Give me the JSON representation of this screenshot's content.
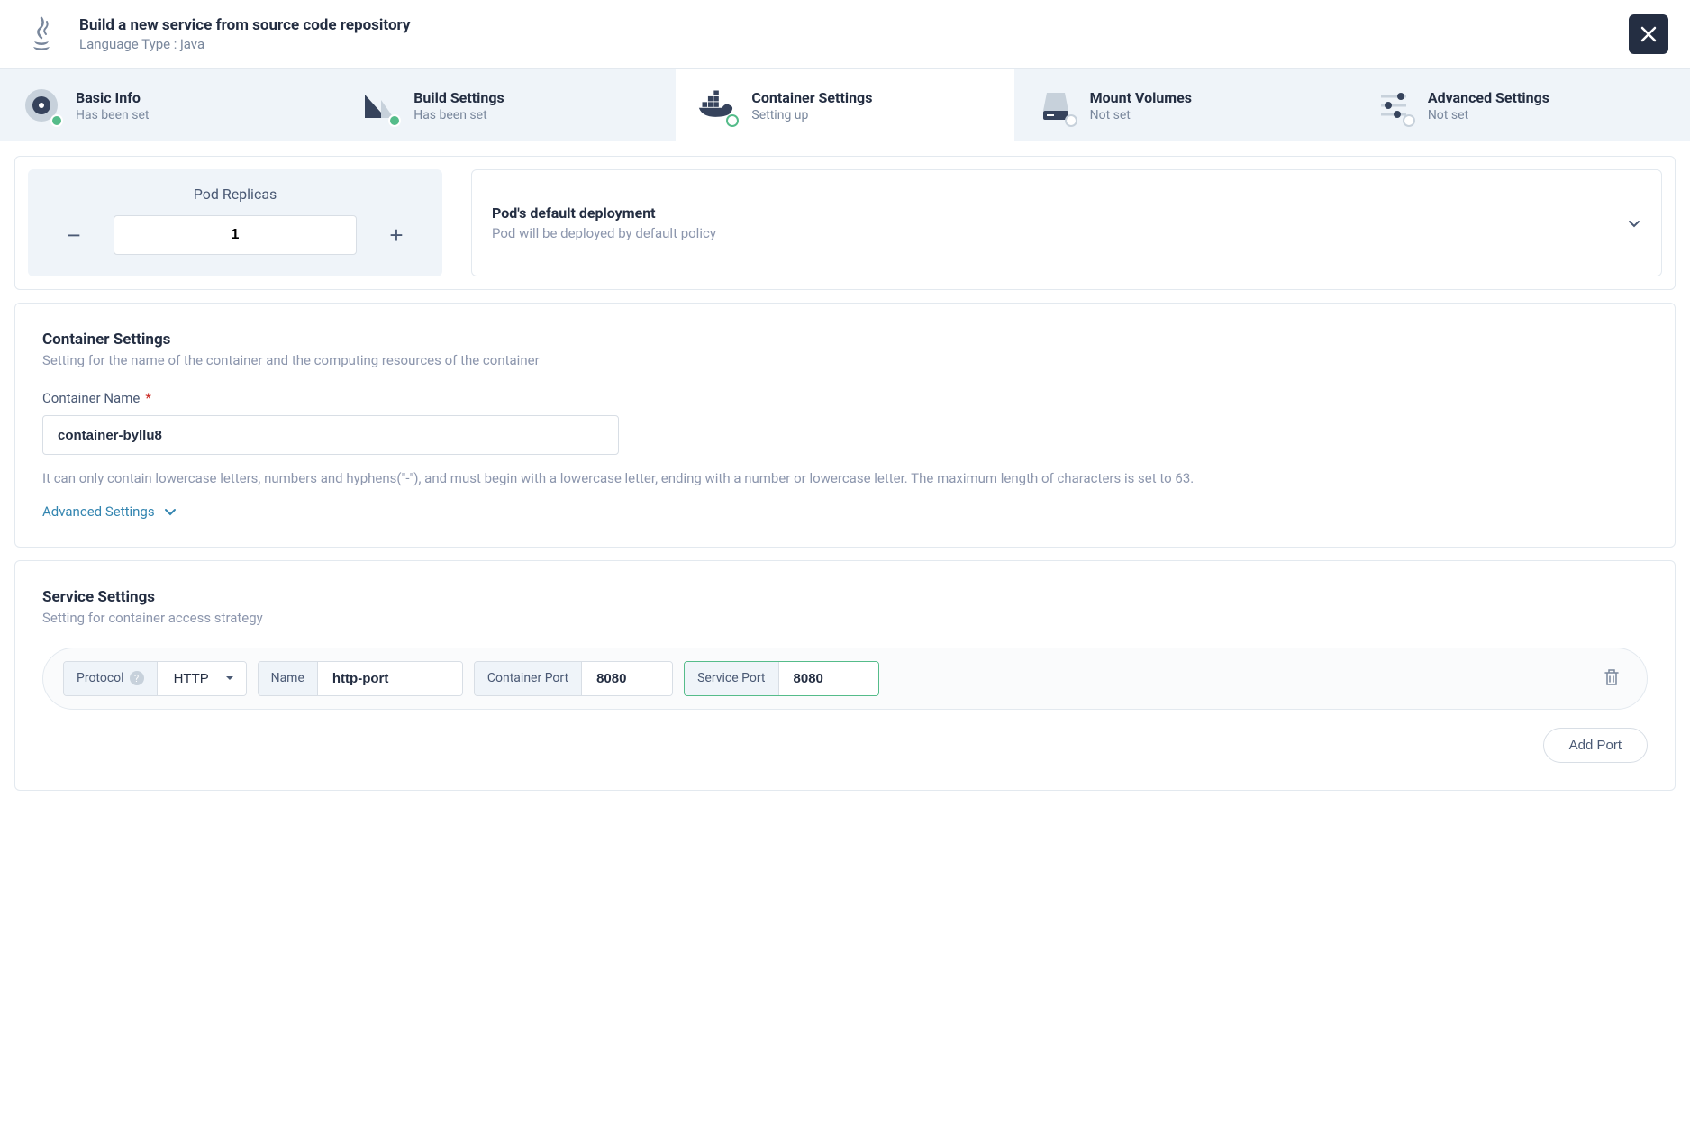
{
  "header": {
    "title": "Build a new service from source code repository",
    "subtitle": "Language Type : java"
  },
  "tabs": [
    {
      "title": "Basic Info",
      "status": "Has been set"
    },
    {
      "title": "Build Settings",
      "status": "Has been set"
    },
    {
      "title": "Container Settings",
      "status": "Setting up"
    },
    {
      "title": "Mount Volumes",
      "status": "Not set"
    },
    {
      "title": "Advanced Settings",
      "status": "Not set"
    }
  ],
  "pod": {
    "label": "Pod Replicas",
    "value": "1"
  },
  "deployment": {
    "title": "Pod's default deployment",
    "desc": "Pod will be deployed by default policy"
  },
  "containerSettings": {
    "title": "Container Settings",
    "subtitle": "Setting for the name of the container and the computing resources of the container",
    "nameLabel": "Container Name",
    "nameValue": "container-byllu8",
    "help": "It can only contain lowercase letters, numbers and hyphens(\"-\"), and must begin with a lowercase letter, ending with a number or lowercase letter. The maximum length of characters is set to 63.",
    "advancedLink": "Advanced Settings"
  },
  "serviceSettings": {
    "title": "Service Settings",
    "subtitle": "Setting for container access strategy",
    "protocolLabel": "Protocol",
    "protocolValue": "HTTP",
    "nameLabel": "Name",
    "nameValue": "http-port",
    "containerPortLabel": "Container Port",
    "containerPortValue": "8080",
    "servicePortLabel": "Service Port",
    "servicePortValue": "8080",
    "addPort": "Add Port"
  }
}
